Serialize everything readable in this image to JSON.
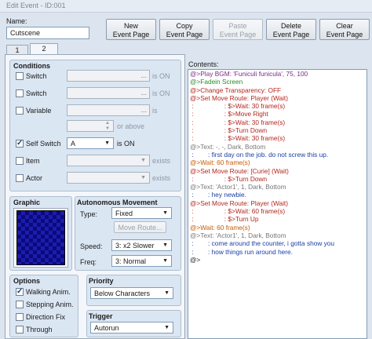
{
  "window": {
    "title": "Edit Event - ID:001"
  },
  "name": {
    "label": "Name:",
    "value": "Cutscene"
  },
  "top_buttons": [
    {
      "l1": "New",
      "l2": "Event Page",
      "enabled": true
    },
    {
      "l1": "Copy",
      "l2": "Event Page",
      "enabled": true
    },
    {
      "l1": "Paste",
      "l2": "Event Page",
      "enabled": false
    },
    {
      "l1": "Delete",
      "l2": "Event Page",
      "enabled": true
    },
    {
      "l1": "Clear",
      "l2": "Event Page",
      "enabled": true
    }
  ],
  "tabs": [
    "1",
    "2"
  ],
  "conditions": {
    "title": "Conditions",
    "switch1": {
      "label": "Switch",
      "value": "",
      "suffix": "is ON",
      "checked": false
    },
    "switch2": {
      "label": "Switch",
      "value": "",
      "suffix": "is ON",
      "checked": false
    },
    "variable": {
      "label": "Variable",
      "value": "",
      "suffix": "is",
      "checked": false
    },
    "variable_value": {
      "value": "",
      "suffix": "or above"
    },
    "self_switch": {
      "label": "Self Switch",
      "value": "A",
      "suffix": "is ON",
      "checked": true
    },
    "item": {
      "label": "Item",
      "value": "",
      "suffix": "exists",
      "checked": false
    },
    "actor": {
      "label": "Actor",
      "value": "",
      "suffix": "exists",
      "checked": false
    }
  },
  "graphic": {
    "title": "Graphic"
  },
  "movement": {
    "title": "Autonomous Movement",
    "type_label": "Type:",
    "type_value": "Fixed",
    "route_button": "Move Route...",
    "speed_label": "Speed:",
    "speed_value": "3: x2 Slower",
    "freq_label": "Freq:",
    "freq_value": "3: Normal"
  },
  "options": {
    "title": "Options",
    "items": [
      {
        "label": "Walking Anim.",
        "checked": true
      },
      {
        "label": "Stepping Anim.",
        "checked": false
      },
      {
        "label": "Direction Fix",
        "checked": false
      },
      {
        "label": "Through",
        "checked": false
      }
    ]
  },
  "priority": {
    "title": "Priority",
    "value": "Below Characters"
  },
  "trigger": {
    "title": "Trigger",
    "value": "Autorun"
  },
  "contents": {
    "label": "Contents:",
    "lines": [
      {
        "text": "@>Play BGM: 'Funiculi funicula', 75, 100",
        "color": "c-purple"
      },
      {
        "text": "@>Fadein Screen",
        "color": "c-green"
      },
      {
        "text": "@>Change Transparency: OFF",
        "color": "c-red"
      },
      {
        "text": "@>Set Move Route: Player (Wait)",
        "color": "c-red"
      },
      {
        "text": " :                 : $>Wait: 30 frame(s)",
        "color": "c-red"
      },
      {
        "text": " :                 : $>Move Right",
        "color": "c-red"
      },
      {
        "text": " :                 : $>Wait: 30 frame(s)",
        "color": "c-red"
      },
      {
        "text": " :                 : $>Turn Down",
        "color": "c-red"
      },
      {
        "text": " :                 : $>Wait: 30 frame(s)",
        "color": "c-red"
      },
      {
        "text": "@>Text: -, -, Dark, Bottom",
        "color": "c-gray"
      },
      {
        "text": " :        : first day on the job. do not screw this up.",
        "color": "c-blue"
      },
      {
        "text": "@>Wait: 60 frame(s)",
        "color": "c-orange"
      },
      {
        "text": "@>Set Move Route: [Curie] (Wait)",
        "color": "c-red"
      },
      {
        "text": " :                 : $>Turn Down",
        "color": "c-red"
      },
      {
        "text": "@>Text: 'Actor1', 1, Dark, Bottom",
        "color": "c-gray"
      },
      {
        "text": " :        : hey newbie.",
        "color": "c-blue"
      },
      {
        "text": "@>Set Move Route: Player (Wait)",
        "color": "c-red"
      },
      {
        "text": " :                 : $>Wait: 60 frame(s)",
        "color": "c-red"
      },
      {
        "text": " :                 : $>Turn Up",
        "color": "c-red"
      },
      {
        "text": "@>Wait: 60 frame(s)",
        "color": "c-orange"
      },
      {
        "text": "@>Text: 'Actor1', 1, Dark, Bottom",
        "color": "c-gray"
      },
      {
        "text": " :        : come around the counter, i gotta show you",
        "color": "c-blue"
      },
      {
        "text": " :        : how things run around here.",
        "color": "c-blue"
      },
      {
        "text": "@>",
        "color": "c-dark"
      }
    ]
  }
}
